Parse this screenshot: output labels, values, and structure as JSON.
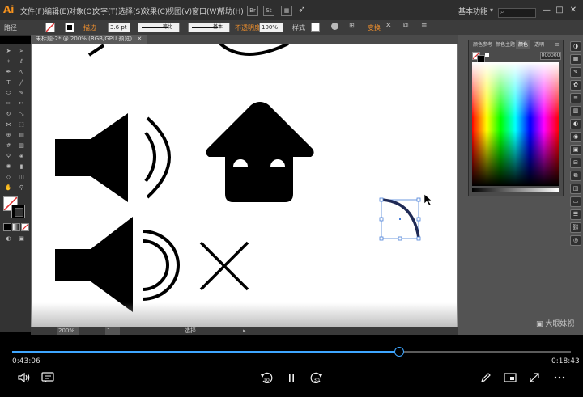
{
  "app": {
    "logo": "Ai"
  },
  "menubar": {
    "items": [
      "文件(F)",
      "编辑(E)",
      "对象(O)",
      "文字(T)",
      "选择(S)",
      "效果(C)",
      "视图(V)",
      "窗口(W)",
      "帮助(H)"
    ],
    "workspace_label": "基本功能",
    "window_controls": {
      "minimize": "—",
      "restore": "□",
      "close": "✕"
    }
  },
  "controlbar": {
    "object_type": "路径",
    "stroke_label": "描边",
    "stroke_weight": "3.6 pt",
    "stroke_profile": "等比",
    "brush": "基本",
    "opacity_label": "不透明度",
    "opacity_value": "100%",
    "style_label": "样式",
    "shape_label": "变换"
  },
  "document": {
    "tab_title": "未标题-2* @ 200% (RGB/GPU 预览)",
    "tab_close": "✕"
  },
  "statusbar": {
    "zoom": "200%",
    "page": "1",
    "tool_label": "选择"
  },
  "panel": {
    "tabs": [
      "颜色参考",
      "颜色主题",
      "颜色",
      "透明"
    ],
    "active_tab": 2,
    "hex_value": "000000"
  },
  "watermark": "大眼妹视",
  "player": {
    "current_time": "0:43:06",
    "total_time": "0:18:43",
    "progress_fraction": 0.693,
    "skip_back_label": "10",
    "skip_forward_label": "30"
  },
  "colors": {
    "accent": "#3ea6ff",
    "illustrator_orange": "#f7931e",
    "selection_blue": "#4a7fd8"
  },
  "icons": [
    "volume-icon",
    "captions-icon",
    "rewind-10-icon",
    "pause-icon",
    "forward-30-icon",
    "edit-pen-icon",
    "picture-in-picture-icon",
    "fullscreen-icon",
    "more-icon"
  ]
}
